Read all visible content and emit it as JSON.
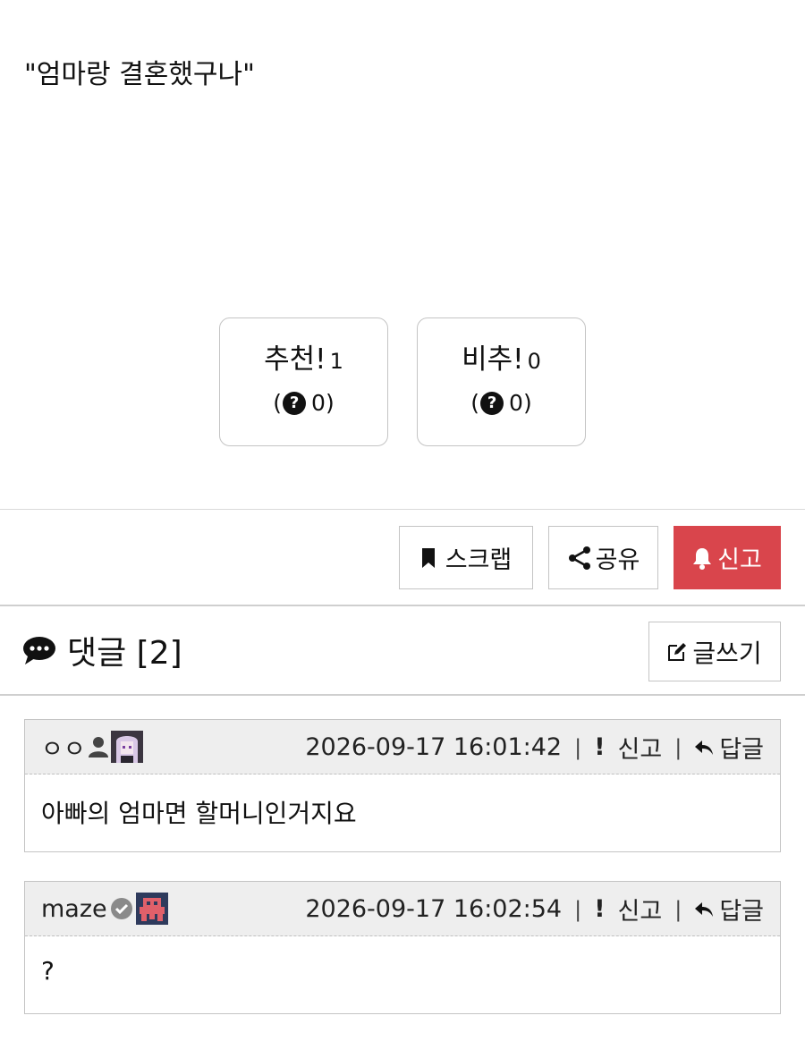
{
  "post": {
    "text": "\"엄마랑 결혼했구나\""
  },
  "votes": {
    "up": {
      "label": "추천!",
      "count": "1",
      "sub_open": "(",
      "sub_count": "0)"
    },
    "down": {
      "label": "비추!",
      "count": "0",
      "sub_open": "(",
      "sub_count": "0)"
    }
  },
  "actions": {
    "scrap": "스크랩",
    "share": "공유",
    "report": "신고",
    "report_color": "#d9454c"
  },
  "comments_section": {
    "title": "댓글 [2]",
    "write": "글쓰기"
  },
  "comments": [
    {
      "author": "ㅇㅇ",
      "timestamp": "2026-09-17 16:01:42",
      "report": "신고",
      "reply": "답글",
      "body": "아빠의 엄마면 할머니인거지요"
    },
    {
      "author": "maze",
      "timestamp": "2026-09-17 16:02:54",
      "report": "신고",
      "reply": "답글",
      "body": "?"
    }
  ],
  "icons": {
    "bookmark": "bookmark-icon",
    "share": "share-icon",
    "bell": "bell-icon",
    "chat": "chat-bubble-icon",
    "edit": "edit-icon",
    "question": "question-circle-icon",
    "reply": "reply-arrow-icon"
  }
}
